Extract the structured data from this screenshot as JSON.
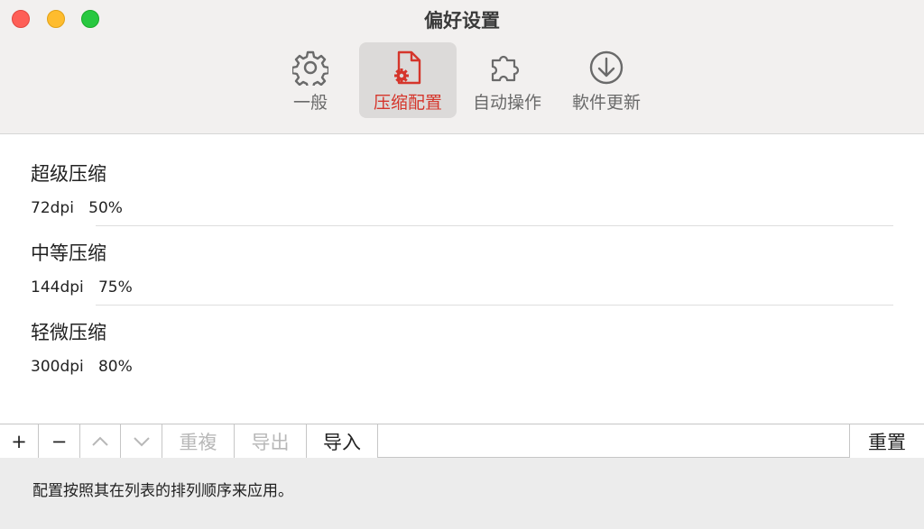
{
  "window": {
    "title": "偏好设置"
  },
  "toolbar": {
    "tabs": [
      {
        "label": "一般",
        "icon": "gear-icon"
      },
      {
        "label": "压缩配置",
        "icon": "document-gear-icon",
        "selected": true
      },
      {
        "label": "自动操作",
        "icon": "puzzle-icon"
      },
      {
        "label": "軟件更新",
        "icon": "download-circle-icon"
      }
    ]
  },
  "presets": [
    {
      "name": "超级压缩",
      "dpi": "72dpi",
      "quality": "50%"
    },
    {
      "name": "中等压缩",
      "dpi": "144dpi",
      "quality": "75%"
    },
    {
      "name": "轻微压缩",
      "dpi": "300dpi",
      "quality": "80%"
    }
  ],
  "buttons": {
    "add": "+",
    "remove": "−",
    "duplicate": "重複",
    "export": "导出",
    "import": "导入",
    "reset": "重置"
  },
  "footer": {
    "note": "配置按照其在列表的排列顺序来应用。"
  },
  "colors": {
    "accent": "#d5352b",
    "selected_tab_bg": "#dcdad9"
  }
}
